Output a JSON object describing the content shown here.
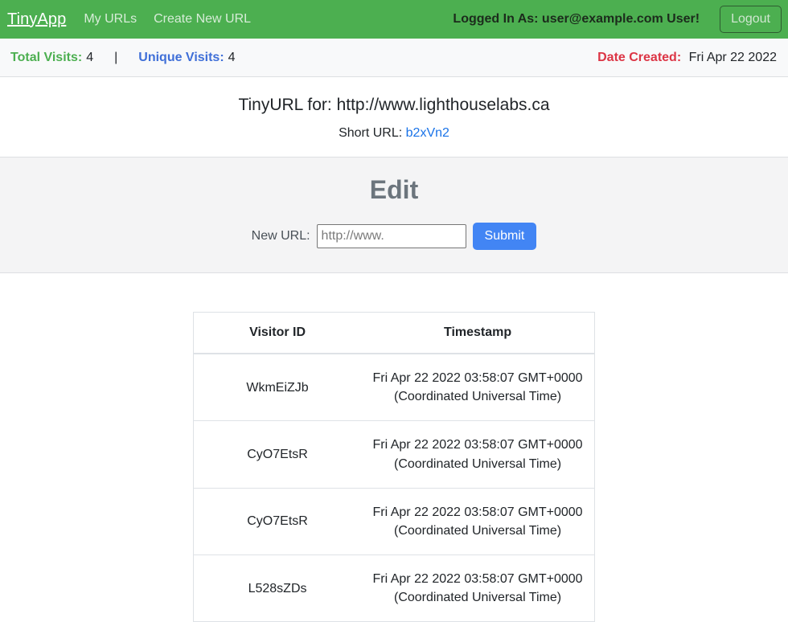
{
  "navbar": {
    "brand": "TinyApp",
    "links": [
      {
        "label": "My URLs"
      },
      {
        "label": "Create New URL"
      }
    ],
    "logged_in_text": "Logged In As: user@example.com User!",
    "logout_label": "Logout",
    "background_color": "#4caf50"
  },
  "stats": {
    "total_visits_label": "Total Visits:",
    "total_visits_value": "4",
    "separator": "|",
    "unique_visits_label": "Unique Visits:",
    "unique_visits_value": "4",
    "date_created_label": "Date Created:",
    "date_created_value": "Fri Apr 22 2022",
    "total_color": "#4caf50",
    "unique_color": "#3f6fd8",
    "date_color": "#dc3545"
  },
  "url_header": {
    "title": "TinyURL for: http://www.lighthouselabs.ca",
    "short_url_label": "Short URL:",
    "short_url_value": "b2xVn2",
    "link_color": "#1a73e8"
  },
  "edit": {
    "heading": "Edit",
    "field_label": "New URL:",
    "input_value": "",
    "input_placeholder": "http://www.",
    "submit_label": "Submit",
    "submit_color": "#4285f4"
  },
  "visits_table": {
    "columns": [
      "Visitor ID",
      "Timestamp"
    ],
    "rows": [
      {
        "visitor_id": "WkmEiZJb",
        "timestamp": "Fri Apr 22 2022 03:58:07 GMT+0000 (Coordinated Universal Time)"
      },
      {
        "visitor_id": "CyO7EtsR",
        "timestamp": "Fri Apr 22 2022 03:58:07 GMT+0000 (Coordinated Universal Time)"
      },
      {
        "visitor_id": "CyO7EtsR",
        "timestamp": "Fri Apr 22 2022 03:58:07 GMT+0000 (Coordinated Universal Time)"
      },
      {
        "visitor_id": "L528sZDs",
        "timestamp": "Fri Apr 22 2022 03:58:07 GMT+0000 (Coordinated Universal Time)"
      }
    ]
  }
}
